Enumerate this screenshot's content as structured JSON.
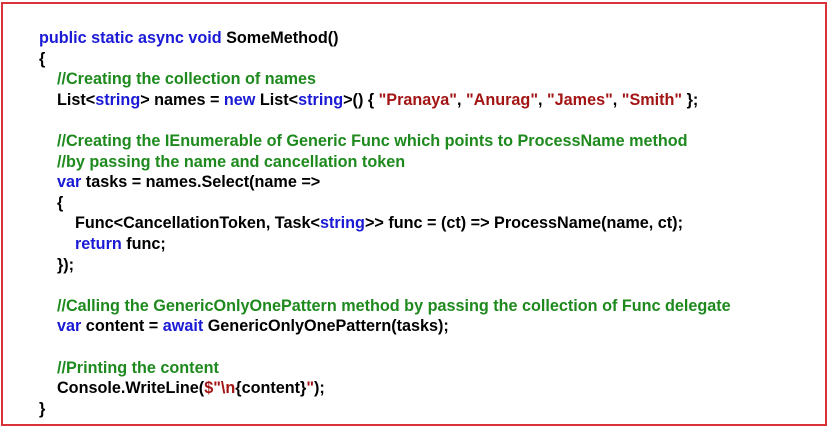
{
  "colors": {
    "border": "#d9323a",
    "keyword": "#1a1ad6",
    "comment": "#1e8a1e",
    "string": "#a31515",
    "plain": "#000000"
  },
  "code": {
    "lines": [
      [
        {
          "t": "kw",
          "v": "public static async void"
        },
        {
          "t": "pl",
          "v": " SomeMethod()"
        }
      ],
      [
        {
          "t": "pl",
          "v": "{"
        }
      ],
      [
        {
          "t": "cm",
          "v": "    //Creating the collection of names"
        }
      ],
      [
        {
          "t": "pl",
          "v": "    List<"
        },
        {
          "t": "kw",
          "v": "string"
        },
        {
          "t": "pl",
          "v": "> names = "
        },
        {
          "t": "kw",
          "v": "new"
        },
        {
          "t": "pl",
          "v": " List<"
        },
        {
          "t": "kw",
          "v": "string"
        },
        {
          "t": "pl",
          "v": ">() { "
        },
        {
          "t": "st",
          "v": "\"Pranaya\""
        },
        {
          "t": "pl",
          "v": ", "
        },
        {
          "t": "st",
          "v": "\"Anurag\""
        },
        {
          "t": "pl",
          "v": ", "
        },
        {
          "t": "st",
          "v": "\"James\""
        },
        {
          "t": "pl",
          "v": ", "
        },
        {
          "t": "st",
          "v": "\"Smith\""
        },
        {
          "t": "pl",
          "v": " };"
        }
      ],
      [],
      [
        {
          "t": "cm",
          "v": "    //Creating the IEnumerable of Generic Func which points to ProcessName method"
        }
      ],
      [
        {
          "t": "cm",
          "v": "    //by passing the name and cancellation token"
        }
      ],
      [
        {
          "t": "pl",
          "v": "    "
        },
        {
          "t": "kw",
          "v": "var"
        },
        {
          "t": "pl",
          "v": " tasks = names.Select(name =>"
        }
      ],
      [
        {
          "t": "pl",
          "v": "    {"
        }
      ],
      [
        {
          "t": "pl",
          "v": "        Func<CancellationToken, Task<"
        },
        {
          "t": "kw",
          "v": "string"
        },
        {
          "t": "pl",
          "v": ">> func = (ct) => ProcessName(name, ct);"
        }
      ],
      [
        {
          "t": "pl",
          "v": "        "
        },
        {
          "t": "kw",
          "v": "return"
        },
        {
          "t": "pl",
          "v": " func;"
        }
      ],
      [
        {
          "t": "pl",
          "v": "    });"
        }
      ],
      [],
      [
        {
          "t": "cm",
          "v": "    //Calling the GenericOnlyOnePattern method by passing the collection of Func delegate"
        }
      ],
      [
        {
          "t": "pl",
          "v": "    "
        },
        {
          "t": "kw",
          "v": "var"
        },
        {
          "t": "pl",
          "v": " content = "
        },
        {
          "t": "kw",
          "v": "await"
        },
        {
          "t": "pl",
          "v": " GenericOnlyOnePattern(tasks);"
        }
      ],
      [],
      [
        {
          "t": "cm",
          "v": "    //Printing the content"
        }
      ],
      [
        {
          "t": "pl",
          "v": "    Console.WriteLine("
        },
        {
          "t": "st",
          "v": "$\"\\n"
        },
        {
          "t": "pl",
          "v": "{content}"
        },
        {
          "t": "st",
          "v": "\""
        },
        {
          "t": "pl",
          "v": ");"
        }
      ],
      [
        {
          "t": "pl",
          "v": "}"
        }
      ]
    ]
  }
}
